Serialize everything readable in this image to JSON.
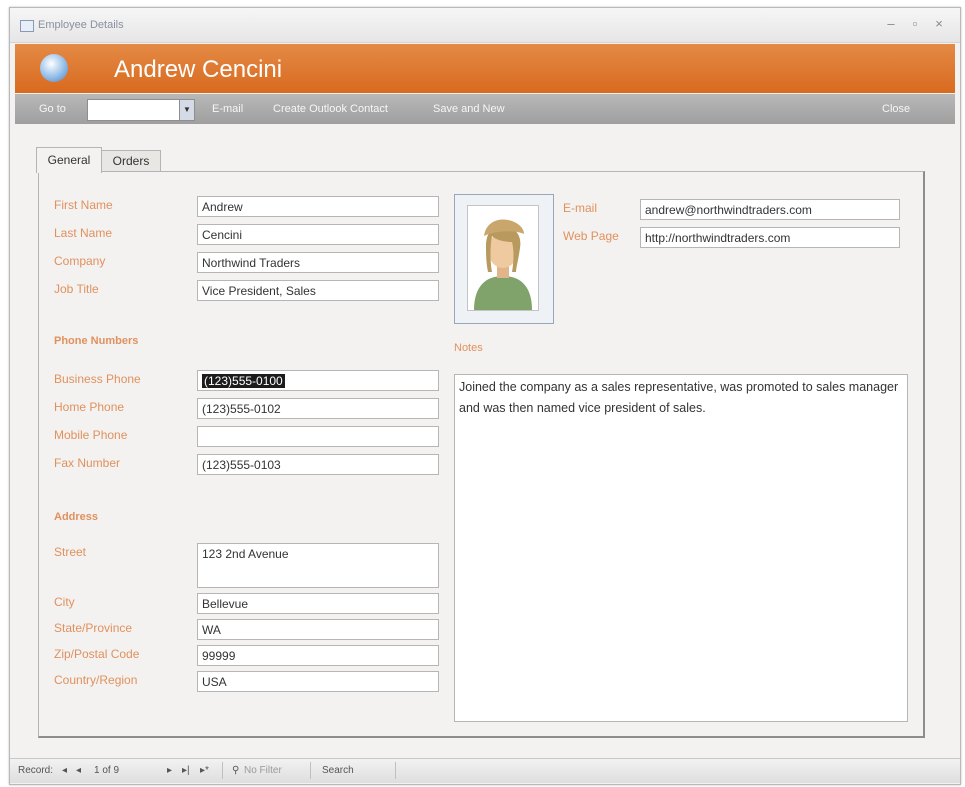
{
  "window": {
    "title": "Employee Details",
    "controls": {
      "minimize": "–",
      "restore": "▫",
      "close": "×"
    }
  },
  "header": {
    "title": "Andrew Cencini"
  },
  "toolbar": {
    "goto_label": "Go to",
    "goto_value": "",
    "email_label": "E-mail",
    "outlook_label": "Create Outlook Contact",
    "save_label": "Save and New",
    "close_label": "Close"
  },
  "tabs": [
    {
      "label": "General",
      "active": true
    },
    {
      "label": "Orders",
      "active": false
    }
  ],
  "general": {
    "first_name": {
      "label": "First Name",
      "value": "Andrew"
    },
    "last_name": {
      "label": "Last Name",
      "value": "Cencini"
    },
    "company": {
      "label": "Company",
      "value": "Northwind Traders"
    },
    "job_title": {
      "label": "Job Title",
      "value": "Vice President, Sales"
    }
  },
  "phone": {
    "heading": "Phone Numbers",
    "business": {
      "label": "Business Phone",
      "value": "(123)555-0100"
    },
    "home": {
      "label": "Home Phone",
      "value": "(123)555-0102"
    },
    "mobile": {
      "label": "Mobile Phone",
      "value": ""
    },
    "fax": {
      "label": "Fax Number",
      "value": "(123)555-0103"
    }
  },
  "address": {
    "heading": "Address",
    "street": {
      "label": "Street",
      "value": "123 2nd Avenue"
    },
    "city": {
      "label": "City",
      "value": "Bellevue"
    },
    "state": {
      "label": "State/Province",
      "value": "WA"
    },
    "zip": {
      "label": "Zip/Postal Code",
      "value": "99999"
    },
    "country": {
      "label": "Country/Region",
      "value": "USA"
    }
  },
  "contact": {
    "email": {
      "label": "E-mail",
      "value": "andrew@northwindtraders.com"
    },
    "web": {
      "label": "Web Page",
      "value": "http://northwindtraders.com"
    }
  },
  "notes": {
    "label": "Notes",
    "value": "Joined the company as a sales representative, was promoted to sales manager and was then named vice president of sales."
  },
  "statusbar": {
    "record_label": "Record:",
    "first": "◂",
    "prev": "◂",
    "position": "1 of 9",
    "next": "▸",
    "last": "▸|",
    "new": "▸*",
    "filter": "No Filter",
    "search": "Search"
  },
  "colors": {
    "banner": "#d86a1f",
    "label": "#e0915e",
    "toolbar": "#a8a8a8"
  }
}
